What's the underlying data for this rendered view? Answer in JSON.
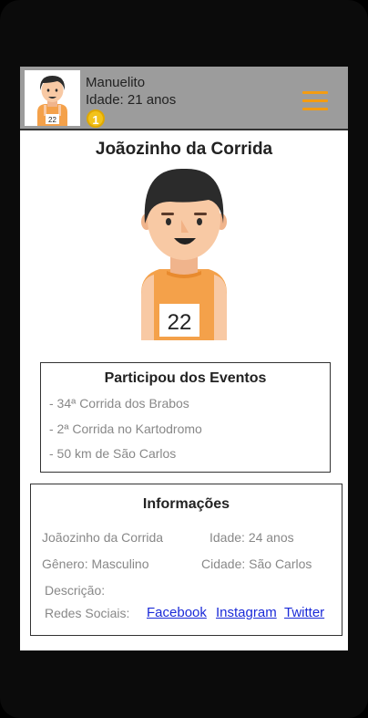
{
  "header": {
    "user_name": "Manuelito",
    "age_label": "Idade: 21 anos",
    "rank": "1",
    "menu_icon": "hamburger-menu-icon"
  },
  "profile": {
    "name": "Joãozinho da Corrida",
    "bib_number": "22"
  },
  "events": {
    "title": "Participou dos Eventos",
    "items": [
      "- 34ª Corrida dos Brabos",
      "- 2ª Corrida no Kartodromo",
      "- 50 km de São Carlos"
    ]
  },
  "info": {
    "title": "Informações",
    "name": "Joãozinho da Corrida",
    "age": "Idade: 24 anos",
    "gender": "Gênero: Masculino",
    "city": "Cidade: São Carlos",
    "description_label": "Descrição:",
    "social_label": "Redes Sociais:",
    "social_links": [
      "Facebook",
      "Instagram",
      "Twitter"
    ]
  },
  "colors": {
    "accent": "#f39c12",
    "header_bg": "#9c9c9c",
    "link": "#1a2ad8"
  }
}
